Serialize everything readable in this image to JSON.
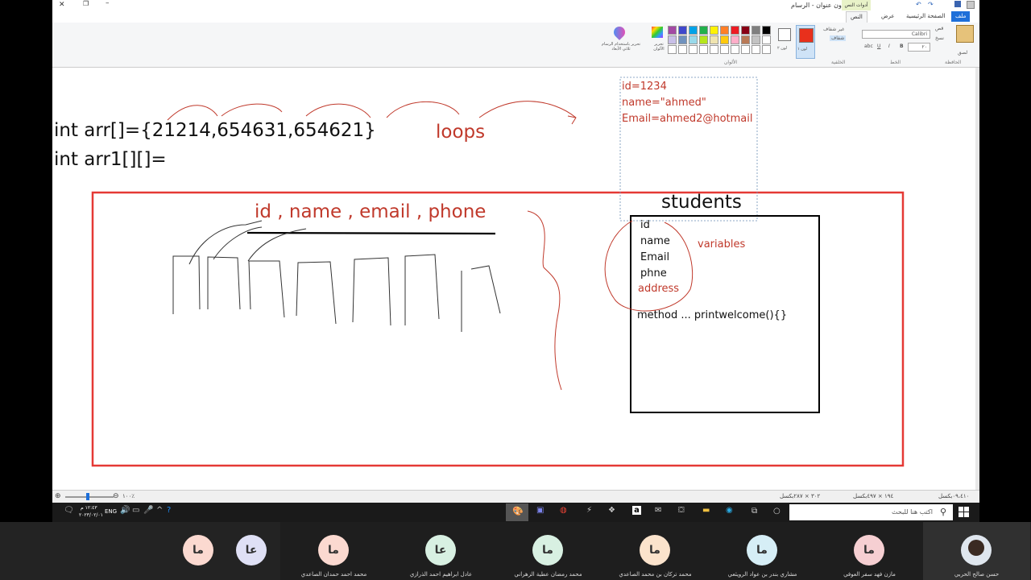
{
  "window": {
    "title": "بدون عنوان - الرسام",
    "tabs": [
      "ملف",
      "الصفحة الرئيسية",
      "عرض",
      "النص"
    ],
    "context_tab": "أدوات النص"
  },
  "ribbon": {
    "clipboard": {
      "group": "الحافظة",
      "paste": "لصق",
      "cut": "قص",
      "copy": "نسخ"
    },
    "font": {
      "group": "الخط",
      "font_name": "Calibri",
      "font_size": "٢٠"
    },
    "background": {
      "group": "الخلفية",
      "opaque": "غير شفاف",
      "transparent": "شفاف"
    },
    "colors": {
      "group": "الألوان",
      "color1_label": "لون ١",
      "color2_label": "لون ٢",
      "edit_colors": "تحرير الألوان",
      "edit_3d": "تحرير باستخدام الرسام ثلاثي الأبعاد",
      "color1": "#e8301c",
      "color2": "#ffffff",
      "palette": [
        "#000000",
        "#7f7f7f",
        "#880015",
        "#ed1c24",
        "#ff7f27",
        "#fff200",
        "#22b14c",
        "#00a2e8",
        "#3f48cc",
        "#a349a4",
        "#ffffff",
        "#c3c3c3",
        "#b97a57",
        "#ffaec9",
        "#ffc90e",
        "#efe4b0",
        "#b5e61d",
        "#99d9ea",
        "#7092be",
        "#c8bfe7"
      ]
    }
  },
  "canvas": {
    "line1": "int arr[]={21214,654631,654621}",
    "line2": "int arr1[][]=",
    "loops": "loops",
    "textbox_lines": [
      "id=1234",
      "name=\"ahmed\"",
      "Email=ahmed2@hotmail"
    ],
    "heading": "id , name , email , phone",
    "students_title": "students",
    "student_fields": [
      "id",
      "name",
      "Email",
      "phne"
    ],
    "address": "address",
    "variables": "variables",
    "method": "method  ... printwelcome(){}",
    "pen_color": "#c0392b",
    "frame_color": "#e53935"
  },
  "status": {
    "position": "٠٩،٤١٠بكسل",
    "selection": "١٩٤ × ٤٩٧بكسل",
    "size": "٣٠٢ × ٢٨٧بكسل",
    "zoom": "١٠٠٪"
  },
  "taskbar": {
    "search_placeholder": "اكتب هنا للبحث",
    "time": "١٢:٤٣ م",
    "date": "٢٠٢٣/٠٢/٠١",
    "lang": "ENG"
  },
  "participants": [
    {
      "initials": "ما",
      "name": "حسن صالح الحربي",
      "color": "#ffffff",
      "is_photo": true
    },
    {
      "initials": "ما",
      "name": "مازن فهد سفر العوفي",
      "color": "#f6cfd2"
    },
    {
      "initials": "ما",
      "name": "مشاري بندر بن عواد الرويثعي",
      "color": "#d6eef6"
    },
    {
      "initials": "ما",
      "name": "محمد تركان بن محمد الصاعدي",
      "color": "#fbe3cc"
    },
    {
      "initials": "ما",
      "name": "محمد رمضان عطية الزهراني",
      "color": "#d8f0e2"
    },
    {
      "initials": "عا",
      "name": "عادل ابراهيم احمد الذرازي",
      "color": "#d8f0e2"
    },
    {
      "initials": "ما",
      "name": "محمد احمد حمدان الصاعدي",
      "color": "#fbd9d0"
    },
    {
      "initials": "عا",
      "name": "",
      "color": "#dfe0f5"
    },
    {
      "initials": "ما",
      "name": "",
      "color": "#fbd9d0"
    }
  ]
}
